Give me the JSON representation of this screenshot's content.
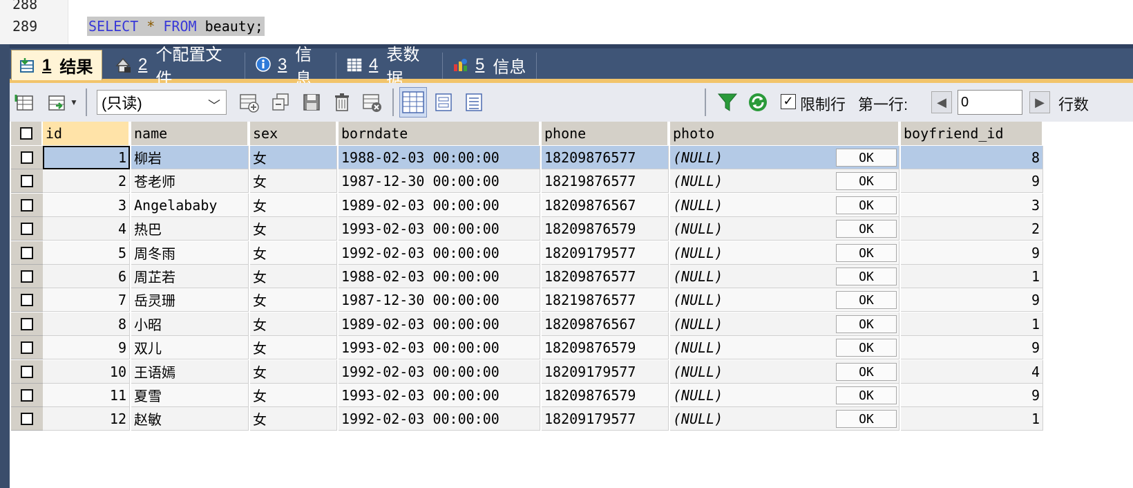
{
  "editor": {
    "line_numbers": [
      "288",
      "289"
    ],
    "sql": {
      "select": "SELECT",
      "star": "*",
      "from": "FROM",
      "table": "beauty",
      "semi": ";"
    }
  },
  "tabs": [
    {
      "num": "1",
      "label": "结果",
      "icon": "result-table-icon"
    },
    {
      "num": "2",
      "label": "个配置文件",
      "icon": "profile-icon"
    },
    {
      "num": "3",
      "label": "信息",
      "icon": "info-icon"
    },
    {
      "num": "4",
      "label": "表数据",
      "icon": "table-data-icon"
    },
    {
      "num": "5",
      "label": "信息",
      "icon": "info-chart-icon"
    }
  ],
  "toolbar": {
    "readonly_select": "(只读)",
    "limit_rows_label": "限制行",
    "first_row_label": "第一行:",
    "first_row_value": "0",
    "rows_label": "行数"
  },
  "grid": {
    "columns": [
      "id",
      "name",
      "sex",
      "borndate",
      "phone",
      "photo",
      "boyfriend_id"
    ],
    "ok_label": "OK",
    "rows": [
      [
        "1",
        "柳岩",
        "女",
        "1988-02-03 00:00:00",
        "18209876577",
        "(NULL)",
        "8"
      ],
      [
        "2",
        "苍老师",
        "女",
        "1987-12-30 00:00:00",
        "18219876577",
        "(NULL)",
        "9"
      ],
      [
        "3",
        "Angelababy",
        "女",
        "1989-02-03 00:00:00",
        "18209876567",
        "(NULL)",
        "3"
      ],
      [
        "4",
        "热巴",
        "女",
        "1993-02-03 00:00:00",
        "18209876579",
        "(NULL)",
        "2"
      ],
      [
        "5",
        "周冬雨",
        "女",
        "1992-02-03 00:00:00",
        "18209179577",
        "(NULL)",
        "9"
      ],
      [
        "6",
        "周芷若",
        "女",
        "1988-02-03 00:00:00",
        "18209876577",
        "(NULL)",
        "1"
      ],
      [
        "7",
        "岳灵珊",
        "女",
        "1987-12-30 00:00:00",
        "18219876577",
        "(NULL)",
        "9"
      ],
      [
        "8",
        "小昭",
        "女",
        "1989-02-03 00:00:00",
        "18209876567",
        "(NULL)",
        "1"
      ],
      [
        "9",
        "双儿",
        "女",
        "1993-02-03 00:00:00",
        "18209876579",
        "(NULL)",
        "9"
      ],
      [
        "10",
        "王语嫣",
        "女",
        "1992-02-03 00:00:00",
        "18209179577",
        "(NULL)",
        "4"
      ],
      [
        "11",
        "夏雪",
        "女",
        "1993-02-03 00:00:00",
        "18209876579",
        "(NULL)",
        "9"
      ],
      [
        "12",
        "赵敏",
        "女",
        "1992-02-03 00:00:00",
        "18209179577",
        "(NULL)",
        "1"
      ]
    ]
  },
  "colors": {
    "tabbar": "#3f5577",
    "accent": "#f2c46b",
    "selection": "#b4cae6"
  }
}
